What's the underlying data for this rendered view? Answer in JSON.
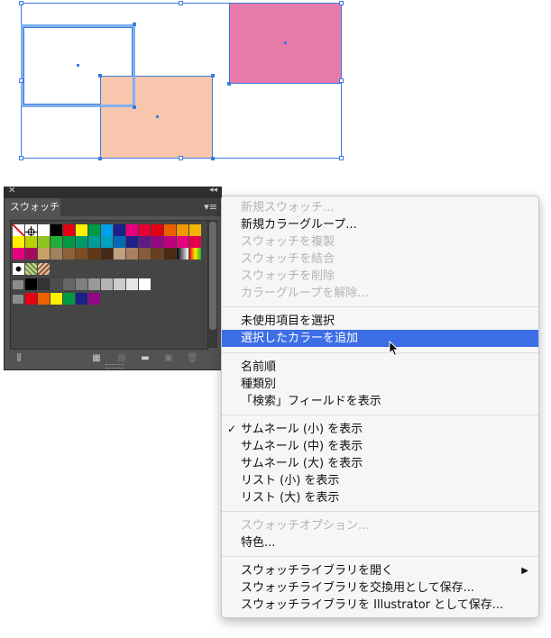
{
  "panel": {
    "tab_label": "スウォッチ",
    "close_glyph": "✕",
    "collapse_glyph": "◂◂",
    "menu_glyph": "▾≡",
    "swatch_rows": [
      [
        "none",
        "registration",
        "#ffffff",
        "#000000",
        "#e60012",
        "#fff100",
        "#009944",
        "#00a0e9",
        "#1d2088",
        "#e4007f",
        "#e60033",
        "#e60012",
        "#eb6100",
        "#f39800",
        "#f4b400"
      ],
      [
        "#fff100",
        "#b8d200",
        "#8fc31f",
        "#22ac38",
        "#009944",
        "#009b6b",
        "#009e96",
        "#00a0c1",
        "#0068b7",
        "#1d2088",
        "#601986",
        "#920783",
        "#be0081",
        "#e4007f",
        "#e5004f"
      ],
      [
        "#e4007f",
        "#a40b5d",
        "#c9a063",
        "#a0835e",
        "#8c6239",
        "#7d4e24",
        "#603813",
        "#452a1a",
        "#c0a080",
        "#ab8060",
        "#8a5a3a",
        "#6a3f20",
        "#4a2a10",
        "gradient1",
        "gradient2"
      ],
      [
        "pattern1",
        "pattern2",
        "pattern3"
      ],
      [
        "folder",
        "#000000",
        "#333333",
        "#4d4d4d",
        "#666666",
        "#808080",
        "#999999",
        "#b3b3b3",
        "#cccccc",
        "#e6e6e6",
        "#ffffff"
      ],
      [
        "folder",
        "#e60012",
        "#eb6100",
        "#fff100",
        "#009944",
        "#1d2088",
        "#920783"
      ]
    ]
  },
  "menu": {
    "items": [
      {
        "label": "新規スウォッチ...",
        "disabled": true
      },
      {
        "label": "新規カラーグループ...",
        "disabled": false
      },
      {
        "label": "スウォッチを複製",
        "disabled": true
      },
      {
        "label": "スウォッチを結合",
        "disabled": true
      },
      {
        "label": "スウォッチを削除",
        "disabled": true
      },
      {
        "label": "カラーグループを解除...",
        "disabled": true
      },
      {
        "label": "未使用項目を選択",
        "disabled": false
      },
      {
        "label": "選択したカラーを追加",
        "disabled": false,
        "highlighted": true
      },
      {
        "label": "名前順",
        "disabled": false
      },
      {
        "label": "種類別",
        "disabled": false
      },
      {
        "label": "「検索」フィールドを表示",
        "disabled": false
      },
      {
        "label": "サムネール (小) を表示",
        "disabled": false,
        "checked": true
      },
      {
        "label": "サムネール (中) を表示",
        "disabled": false
      },
      {
        "label": "サムネール (大) を表示",
        "disabled": false
      },
      {
        "label": "リスト (小) を表示",
        "disabled": false
      },
      {
        "label": "リスト (大) を表示",
        "disabled": false
      },
      {
        "label": "スウォッチオプション...",
        "disabled": true
      },
      {
        "label": "特色...",
        "disabled": false
      },
      {
        "label": "スウォッチライブラリを開く",
        "disabled": false,
        "submenu": true
      },
      {
        "label": "スウォッチライブラリを交換用として保存...",
        "disabled": false
      },
      {
        "label": "スウォッチライブラリを Illustrator として保存...",
        "disabled": false
      }
    ],
    "check_glyph": "✓",
    "submenu_glyph": "▶"
  },
  "colors": {
    "selection_blue": "#3b7be0",
    "pink_rect": "#e87aa9",
    "peach_rect": "#f7c6ad",
    "menu_highlight": "#3d6ee6"
  }
}
